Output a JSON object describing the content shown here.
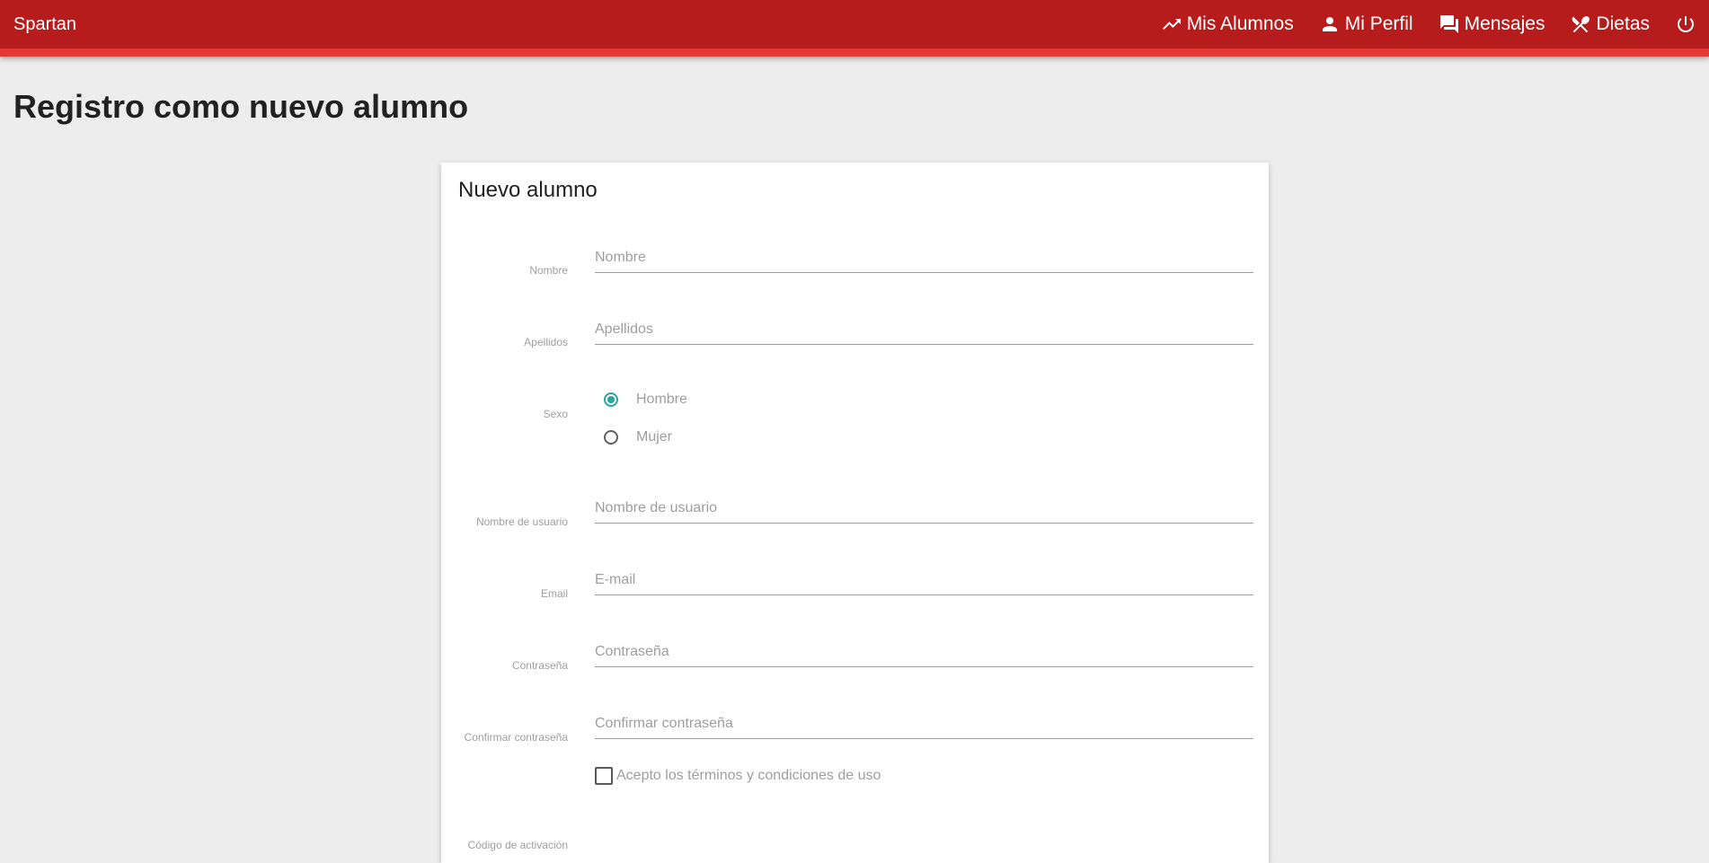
{
  "navbar": {
    "brand": "Spartan",
    "items": [
      {
        "label": "Mis Alumnos",
        "icon": "trending-up-icon"
      },
      {
        "label": "Mi Perfil",
        "icon": "person-icon"
      },
      {
        "label": "Mensajes",
        "icon": "forum-icon"
      },
      {
        "label": "Dietas",
        "icon": "restaurant-icon"
      }
    ],
    "logout_icon": "power-icon"
  },
  "page": {
    "title": "Registro como nuevo alumno"
  },
  "form": {
    "title": "Nuevo alumno",
    "fields": {
      "nombre": {
        "label": "Nombre",
        "placeholder": "Nombre",
        "value": ""
      },
      "apellidos": {
        "label": "Apellidos",
        "placeholder": "Apellidos",
        "value": ""
      },
      "sexo": {
        "label": "Sexo",
        "options": [
          "Hombre",
          "Mujer"
        ],
        "selected": "Hombre"
      },
      "usuario": {
        "label": "Nombre de usuario",
        "placeholder": "Nombre de usuario",
        "value": ""
      },
      "email": {
        "label": "Email",
        "placeholder": "E-mail",
        "value": ""
      },
      "password": {
        "label": "Contraseña",
        "placeholder": "Contraseña",
        "value": ""
      },
      "password_confirm": {
        "label": "Confirmar contraseña",
        "placeholder": "Confirmar contraseña",
        "value": ""
      },
      "terms": {
        "label": "Acepto los términos y condiciones de uso",
        "checked": false
      },
      "codigo": {
        "label": "Código de activación"
      }
    }
  },
  "colors": {
    "navbar": "#b71c1c",
    "navbar_border": "#e53935",
    "accent": "#26a69a",
    "background": "#ededed"
  }
}
